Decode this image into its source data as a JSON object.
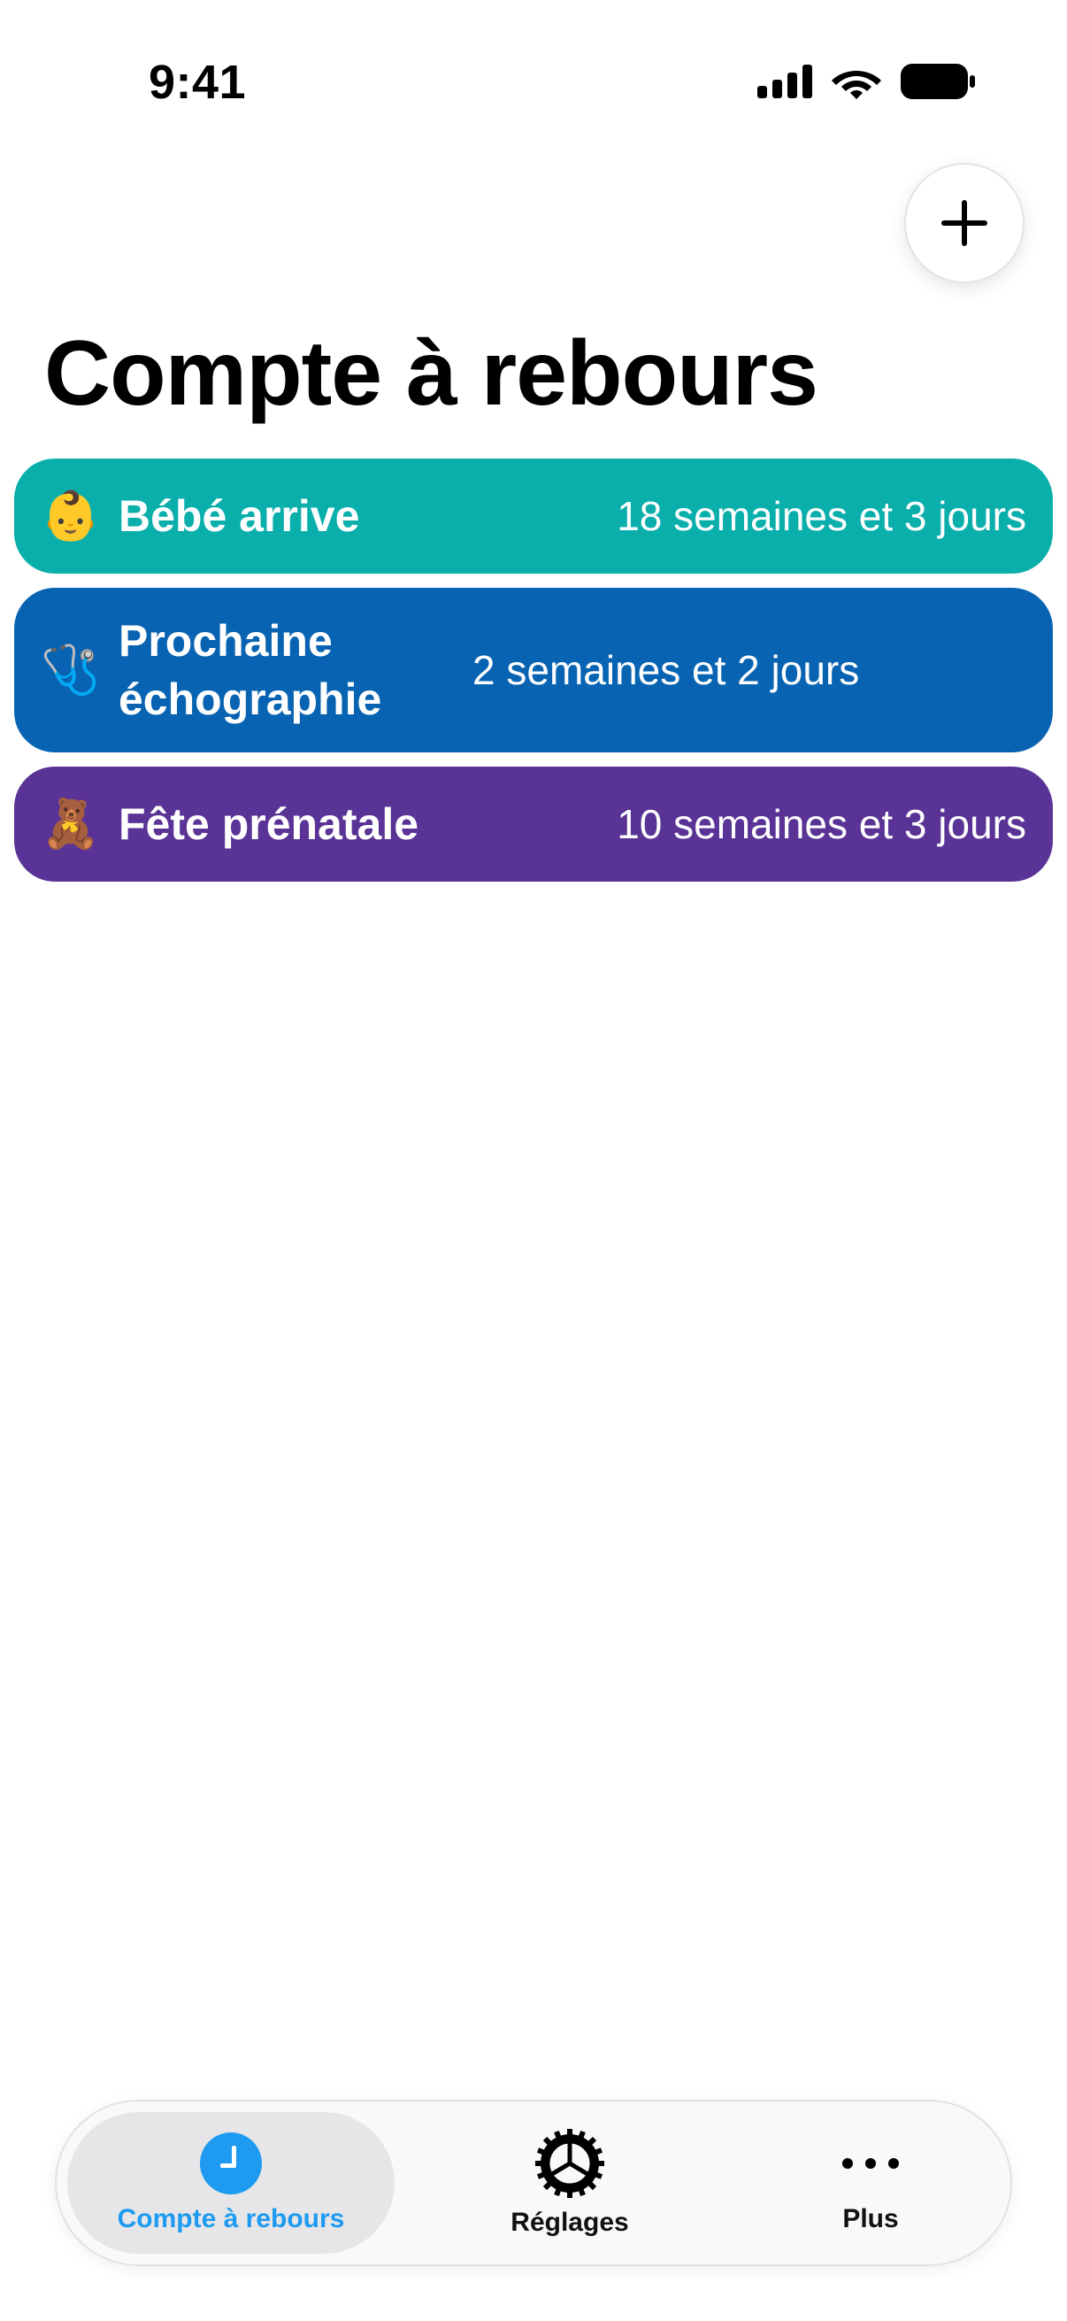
{
  "status_bar": {
    "time": "9:41"
  },
  "header": {
    "title": "Compte à rebours",
    "add_button_icon": "plus-icon"
  },
  "countdowns": [
    {
      "emoji": "👶",
      "title": "Bébé arrive",
      "remaining": "18 semaines et 3 jours",
      "color": "#0aafac"
    },
    {
      "emoji": "🩺",
      "title": "Prochaine échographie",
      "remaining": "2 semaines et 2 jours",
      "color": "#0864b2"
    },
    {
      "emoji": "🧸",
      "title": "Fête prénatale",
      "remaining": "10 semaines et 3 jours",
      "color": "#5a3396"
    }
  ],
  "tab_bar": {
    "active_color": "#1e9bf0",
    "tabs": [
      {
        "label": "Compte à rebours",
        "icon": "clock-icon",
        "active": true
      },
      {
        "label": "Réglages",
        "icon": "gear-icon",
        "active": false
      },
      {
        "label": "Plus",
        "icon": "more-icon",
        "active": false
      }
    ]
  }
}
